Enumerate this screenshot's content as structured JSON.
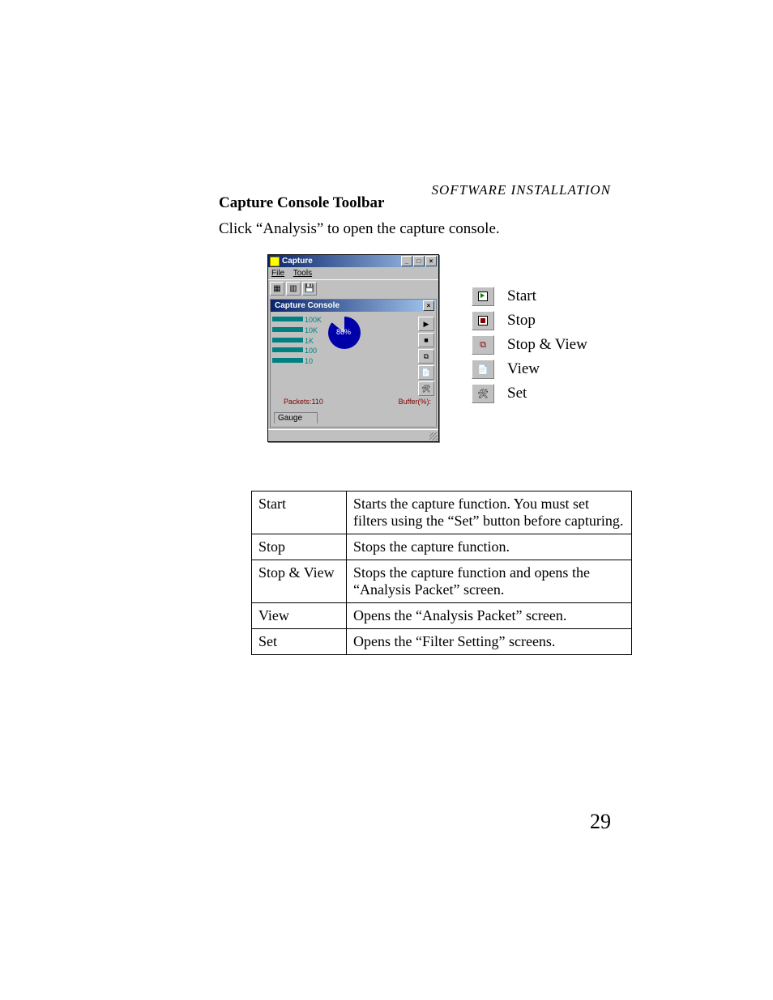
{
  "running_head": "SOFTWARE INSTALLATION",
  "section_title": "Capture Console Toolbar",
  "intro_text": "Click “Analysis” to open the capture console.",
  "capture_window": {
    "title": "Capture",
    "menu_file": "File",
    "menu_tools": "Tools",
    "inner_title": "Capture Console",
    "ticks": [
      "100K",
      "10K",
      "1K",
      "100",
      "10"
    ],
    "pie_percent": "86%",
    "packets_label": "Packets:110",
    "buffer_label": "Buffer(%):",
    "tab_label": "Gauge"
  },
  "legend": {
    "start": "Start",
    "stop": "Stop",
    "stop_view": "Stop & View",
    "view": "View",
    "set": "Set"
  },
  "desc_table": [
    {
      "name": "Start",
      "desc": "Starts the capture function. You must set filters using the “Set” button before capturing."
    },
    {
      "name": "Stop",
      "desc": "Stops the capture function."
    },
    {
      "name": "Stop & View",
      "desc": "Stops the capture function and opens the “Analysis Packet” screen."
    },
    {
      "name": "View",
      "desc": "Opens the “Analysis Packet” screen."
    },
    {
      "name": "Set",
      "desc": "Opens the “Filter Setting” screens."
    }
  ],
  "page_number": "29"
}
